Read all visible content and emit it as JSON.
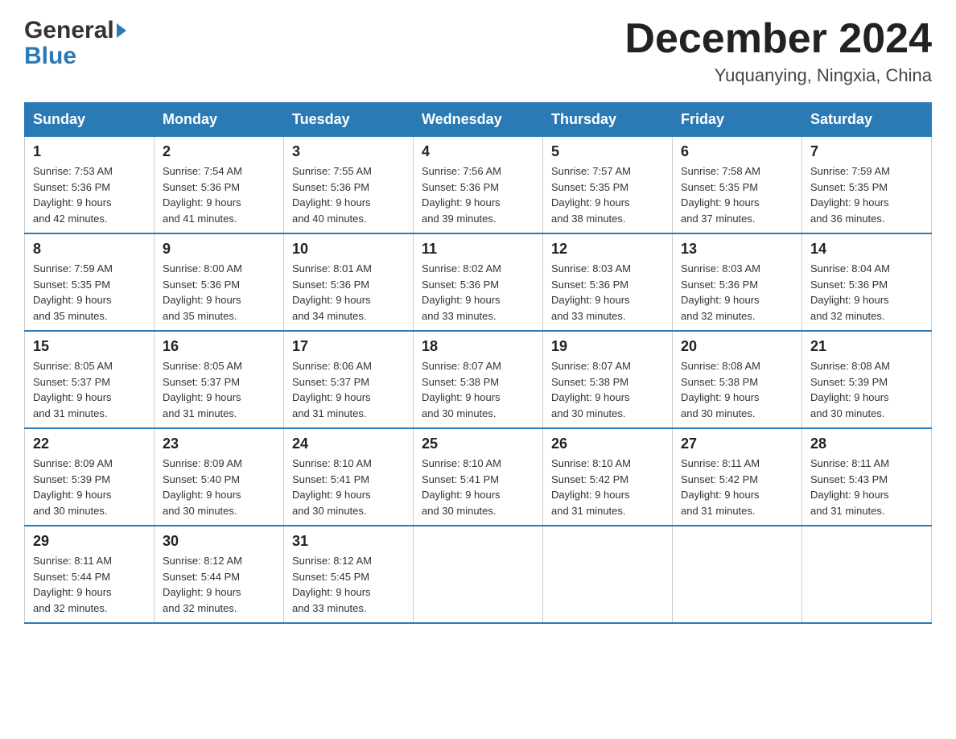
{
  "header": {
    "logo_general": "General",
    "logo_blue": "Blue",
    "month_title": "December 2024",
    "location": "Yuquanying, Ningxia, China"
  },
  "days_of_week": [
    "Sunday",
    "Monday",
    "Tuesday",
    "Wednesday",
    "Thursday",
    "Friday",
    "Saturday"
  ],
  "weeks": [
    [
      {
        "day": "1",
        "info": "Sunrise: 7:53 AM\nSunset: 5:36 PM\nDaylight: 9 hours\nand 42 minutes."
      },
      {
        "day": "2",
        "info": "Sunrise: 7:54 AM\nSunset: 5:36 PM\nDaylight: 9 hours\nand 41 minutes."
      },
      {
        "day": "3",
        "info": "Sunrise: 7:55 AM\nSunset: 5:36 PM\nDaylight: 9 hours\nand 40 minutes."
      },
      {
        "day": "4",
        "info": "Sunrise: 7:56 AM\nSunset: 5:36 PM\nDaylight: 9 hours\nand 39 minutes."
      },
      {
        "day": "5",
        "info": "Sunrise: 7:57 AM\nSunset: 5:35 PM\nDaylight: 9 hours\nand 38 minutes."
      },
      {
        "day": "6",
        "info": "Sunrise: 7:58 AM\nSunset: 5:35 PM\nDaylight: 9 hours\nand 37 minutes."
      },
      {
        "day": "7",
        "info": "Sunrise: 7:59 AM\nSunset: 5:35 PM\nDaylight: 9 hours\nand 36 minutes."
      }
    ],
    [
      {
        "day": "8",
        "info": "Sunrise: 7:59 AM\nSunset: 5:35 PM\nDaylight: 9 hours\nand 35 minutes."
      },
      {
        "day": "9",
        "info": "Sunrise: 8:00 AM\nSunset: 5:36 PM\nDaylight: 9 hours\nand 35 minutes."
      },
      {
        "day": "10",
        "info": "Sunrise: 8:01 AM\nSunset: 5:36 PM\nDaylight: 9 hours\nand 34 minutes."
      },
      {
        "day": "11",
        "info": "Sunrise: 8:02 AM\nSunset: 5:36 PM\nDaylight: 9 hours\nand 33 minutes."
      },
      {
        "day": "12",
        "info": "Sunrise: 8:03 AM\nSunset: 5:36 PM\nDaylight: 9 hours\nand 33 minutes."
      },
      {
        "day": "13",
        "info": "Sunrise: 8:03 AM\nSunset: 5:36 PM\nDaylight: 9 hours\nand 32 minutes."
      },
      {
        "day": "14",
        "info": "Sunrise: 8:04 AM\nSunset: 5:36 PM\nDaylight: 9 hours\nand 32 minutes."
      }
    ],
    [
      {
        "day": "15",
        "info": "Sunrise: 8:05 AM\nSunset: 5:37 PM\nDaylight: 9 hours\nand 31 minutes."
      },
      {
        "day": "16",
        "info": "Sunrise: 8:05 AM\nSunset: 5:37 PM\nDaylight: 9 hours\nand 31 minutes."
      },
      {
        "day": "17",
        "info": "Sunrise: 8:06 AM\nSunset: 5:37 PM\nDaylight: 9 hours\nand 31 minutes."
      },
      {
        "day": "18",
        "info": "Sunrise: 8:07 AM\nSunset: 5:38 PM\nDaylight: 9 hours\nand 30 minutes."
      },
      {
        "day": "19",
        "info": "Sunrise: 8:07 AM\nSunset: 5:38 PM\nDaylight: 9 hours\nand 30 minutes."
      },
      {
        "day": "20",
        "info": "Sunrise: 8:08 AM\nSunset: 5:38 PM\nDaylight: 9 hours\nand 30 minutes."
      },
      {
        "day": "21",
        "info": "Sunrise: 8:08 AM\nSunset: 5:39 PM\nDaylight: 9 hours\nand 30 minutes."
      }
    ],
    [
      {
        "day": "22",
        "info": "Sunrise: 8:09 AM\nSunset: 5:39 PM\nDaylight: 9 hours\nand 30 minutes."
      },
      {
        "day": "23",
        "info": "Sunrise: 8:09 AM\nSunset: 5:40 PM\nDaylight: 9 hours\nand 30 minutes."
      },
      {
        "day": "24",
        "info": "Sunrise: 8:10 AM\nSunset: 5:41 PM\nDaylight: 9 hours\nand 30 minutes."
      },
      {
        "day": "25",
        "info": "Sunrise: 8:10 AM\nSunset: 5:41 PM\nDaylight: 9 hours\nand 30 minutes."
      },
      {
        "day": "26",
        "info": "Sunrise: 8:10 AM\nSunset: 5:42 PM\nDaylight: 9 hours\nand 31 minutes."
      },
      {
        "day": "27",
        "info": "Sunrise: 8:11 AM\nSunset: 5:42 PM\nDaylight: 9 hours\nand 31 minutes."
      },
      {
        "day": "28",
        "info": "Sunrise: 8:11 AM\nSunset: 5:43 PM\nDaylight: 9 hours\nand 31 minutes."
      }
    ],
    [
      {
        "day": "29",
        "info": "Sunrise: 8:11 AM\nSunset: 5:44 PM\nDaylight: 9 hours\nand 32 minutes."
      },
      {
        "day": "30",
        "info": "Sunrise: 8:12 AM\nSunset: 5:44 PM\nDaylight: 9 hours\nand 32 minutes."
      },
      {
        "day": "31",
        "info": "Sunrise: 8:12 AM\nSunset: 5:45 PM\nDaylight: 9 hours\nand 33 minutes."
      },
      {
        "day": "",
        "info": ""
      },
      {
        "day": "",
        "info": ""
      },
      {
        "day": "",
        "info": ""
      },
      {
        "day": "",
        "info": ""
      }
    ]
  ],
  "colors": {
    "header_bg": "#2a7ab5",
    "border": "#2a7ab5",
    "logo_blue": "#2a7ab5"
  }
}
